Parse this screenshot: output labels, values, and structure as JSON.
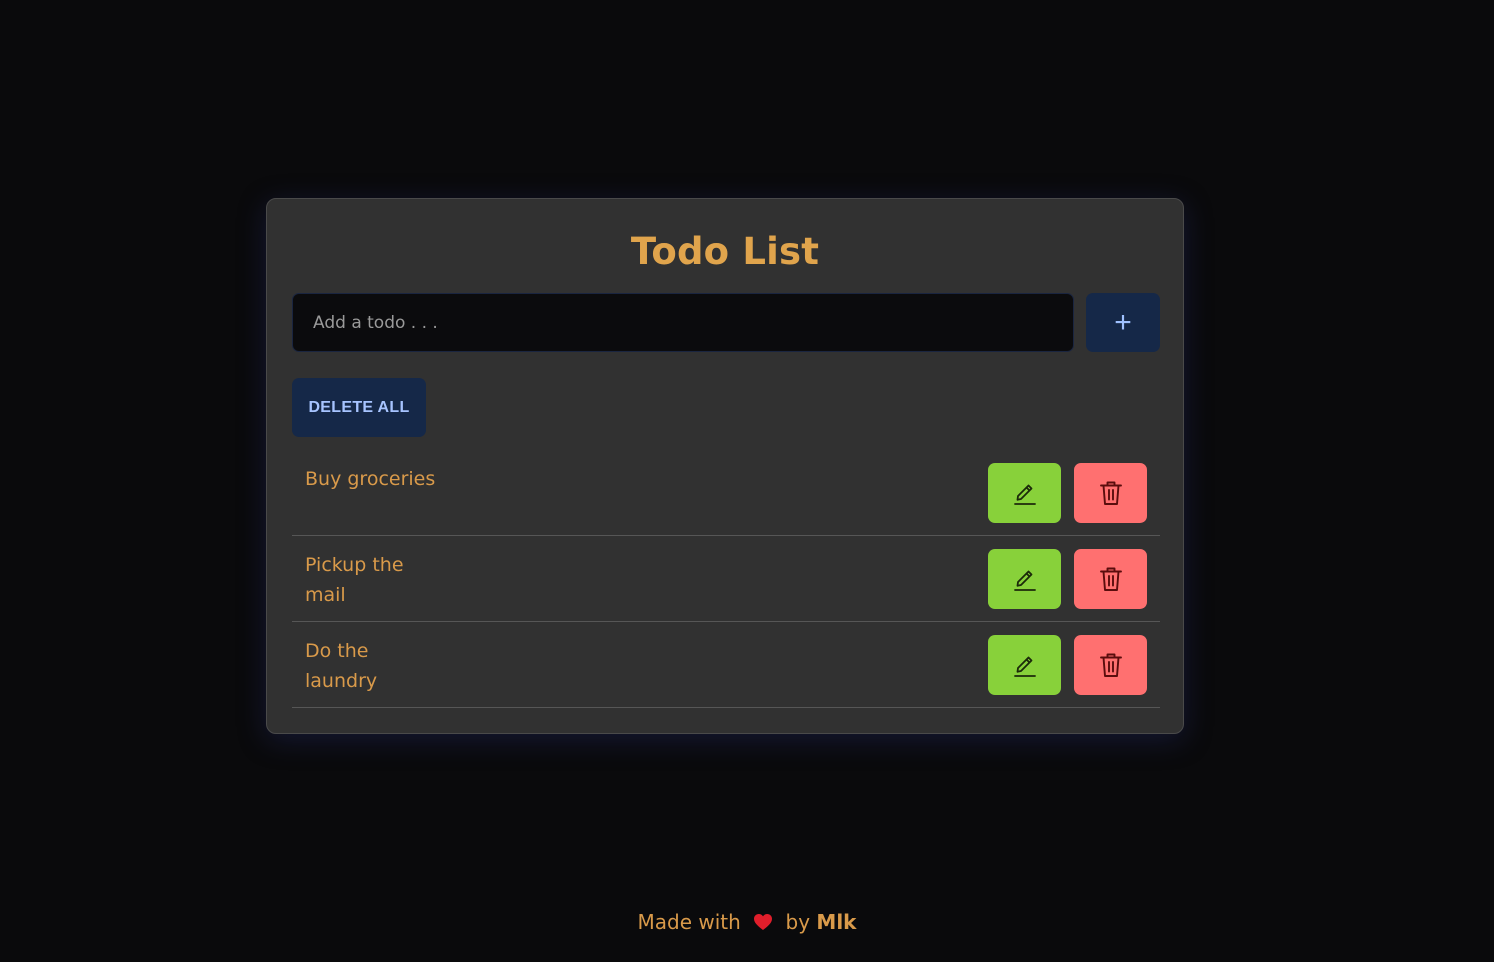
{
  "app": {
    "title": "Todo List"
  },
  "input": {
    "placeholder": "Add a todo . . .",
    "value": ""
  },
  "buttons": {
    "add_label": "+",
    "delete_all_label": "DELETE ALL"
  },
  "todos": [
    {
      "text": "Buy groceries"
    },
    {
      "text": "Pickup the mail"
    },
    {
      "text": "Do the laundry"
    }
  ],
  "footer": {
    "made_with": "Made with",
    "by": "by",
    "author": "Mlk"
  },
  "icons": {
    "add": "plus-icon",
    "edit": "pencil-icon",
    "delete": "trash-icon",
    "footer": "heart-icon"
  },
  "colors": {
    "background": "#0a0a0c",
    "card": "#313131",
    "accent": "#e0a44c",
    "primary_button": "#152848",
    "edit_button": "#88d13a",
    "delete_button": "#ff7070",
    "heart": "#e01e2b"
  }
}
